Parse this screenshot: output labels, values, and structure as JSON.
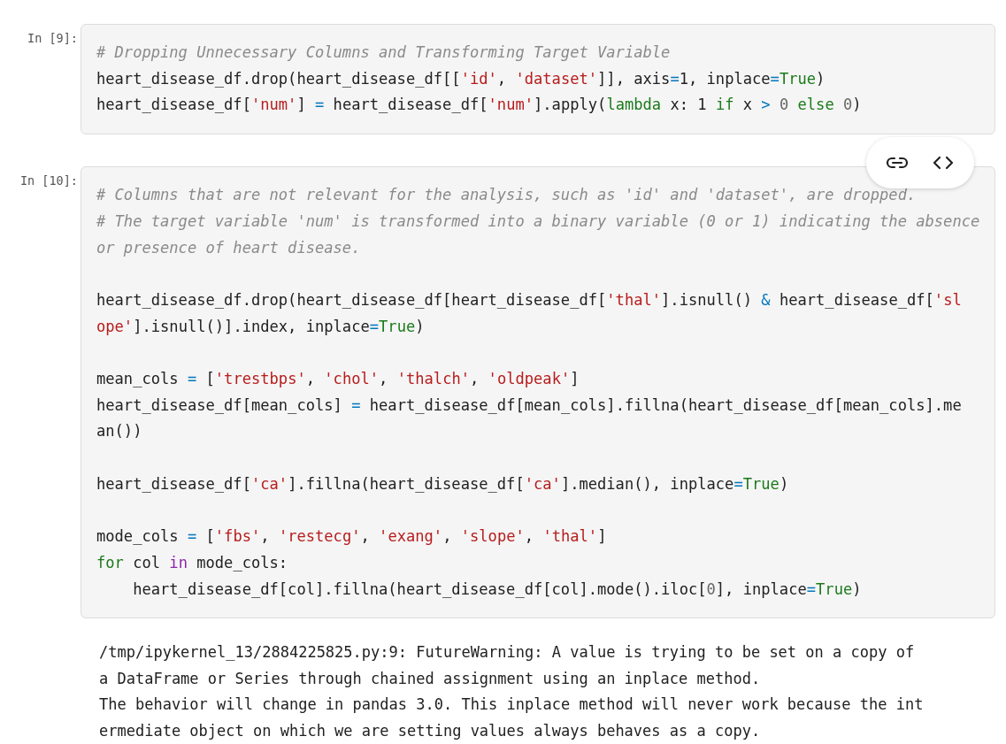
{
  "cells": [
    {
      "prompt": "In [9]:",
      "toolbar": false,
      "lines": [
        {
          "kind": "code",
          "tokens": [
            {
              "text": "# Dropping Unnecessary Columns and Transforming Target Variable",
              "kind": "comment"
            }
          ]
        },
        {
          "kind": "code",
          "tokens": [
            {
              "text": "heart_disease_df.drop(heart_disease_df[[",
              "kind": "plain"
            },
            {
              "text": "'id'",
              "kind": "string"
            },
            {
              "text": ", ",
              "kind": "plain"
            },
            {
              "text": "'dataset'",
              "kind": "string"
            },
            {
              "text": "]], axis",
              "kind": "plain"
            },
            {
              "text": "=",
              "kind": "operator"
            },
            {
              "text": "1",
              "kind": "number"
            },
            {
              "text": ", inplace",
              "kind": "plain"
            },
            {
              "text": "=",
              "kind": "operator"
            },
            {
              "text": "True",
              "kind": "constant"
            },
            {
              "text": ")",
              "kind": "plain"
            }
          ]
        },
        {
          "kind": "code",
          "tokens": [
            {
              "text": "heart_disease_df[",
              "kind": "plain"
            },
            {
              "text": "'num'",
              "kind": "string"
            },
            {
              "text": "] ",
              "kind": "plain"
            },
            {
              "text": "=",
              "kind": "operator"
            },
            {
              "text": " heart_disease_df[",
              "kind": "plain"
            },
            {
              "text": "'num'",
              "kind": "string"
            },
            {
              "text": "].apply(",
              "kind": "plain"
            },
            {
              "text": "lambda",
              "kind": "keyword"
            },
            {
              "text": " x: ",
              "kind": "plain"
            },
            {
              "text": "1",
              "kind": "number"
            },
            {
              "text": " if",
              "kind": "keyword"
            },
            {
              "text": " x ",
              "kind": "plain"
            },
            {
              "text": ">",
              "kind": "operator"
            },
            {
              "text": " 0",
              "kind": "zero"
            },
            {
              "text": " else",
              "kind": "keyword"
            },
            {
              "text": " 0",
              "kind": "zero"
            },
            {
              "text": ")",
              "kind": "plain"
            }
          ]
        }
      ]
    },
    {
      "prompt": "In [10]:",
      "toolbar": true,
      "lines": [
        {
          "kind": "code",
          "tokens": [
            {
              "text": "# Columns that are not relevant for the analysis, such as 'id' and 'dataset', are dropped.",
              "kind": "comment"
            }
          ]
        },
        {
          "kind": "code",
          "tokens": [
            {
              "text": "# The target variable 'num' is transformed into a binary variable (0 or 1) indicating the absence",
              "kind": "comment"
            }
          ]
        },
        {
          "kind": "code",
          "tokens": [
            {
              "text": "or presence of heart disease.",
              "kind": "comment"
            }
          ]
        },
        {
          "kind": "blank"
        },
        {
          "kind": "code",
          "tokens": [
            {
              "text": "heart_disease_df.drop(heart_disease_df[heart_disease_df[",
              "kind": "plain"
            },
            {
              "text": "'thal'",
              "kind": "string"
            },
            {
              "text": "].isnull() ",
              "kind": "plain"
            },
            {
              "text": "&",
              "kind": "operator"
            },
            {
              "text": " heart_disease_df[",
              "kind": "plain"
            },
            {
              "text": "'sl",
              "kind": "string"
            }
          ]
        },
        {
          "kind": "code",
          "tokens": [
            {
              "text": "ope'",
              "kind": "string"
            },
            {
              "text": "].isnull()].index, inplace",
              "kind": "plain"
            },
            {
              "text": "=",
              "kind": "operator"
            },
            {
              "text": "True",
              "kind": "constant"
            },
            {
              "text": ")",
              "kind": "plain"
            }
          ]
        },
        {
          "kind": "blank"
        },
        {
          "kind": "code",
          "tokens": [
            {
              "text": "mean_cols ",
              "kind": "plain"
            },
            {
              "text": "=",
              "kind": "operator"
            },
            {
              "text": " [",
              "kind": "plain"
            },
            {
              "text": "'trestbps'",
              "kind": "string"
            },
            {
              "text": ", ",
              "kind": "plain"
            },
            {
              "text": "'chol'",
              "kind": "string"
            },
            {
              "text": ", ",
              "kind": "plain"
            },
            {
              "text": "'thalch'",
              "kind": "string"
            },
            {
              "text": ", ",
              "kind": "plain"
            },
            {
              "text": "'oldpeak'",
              "kind": "string"
            },
            {
              "text": "]",
              "kind": "plain"
            }
          ]
        },
        {
          "kind": "code",
          "tokens": [
            {
              "text": "heart_disease_df[mean_cols] ",
              "kind": "plain"
            },
            {
              "text": "=",
              "kind": "operator"
            },
            {
              "text": " heart_disease_df[mean_cols].fillna(heart_disease_df[mean_cols].me",
              "kind": "plain"
            }
          ]
        },
        {
          "kind": "code",
          "tokens": [
            {
              "text": "an())",
              "kind": "plain"
            }
          ]
        },
        {
          "kind": "blank"
        },
        {
          "kind": "code",
          "tokens": [
            {
              "text": "heart_disease_df[",
              "kind": "plain"
            },
            {
              "text": "'ca'",
              "kind": "string"
            },
            {
              "text": "].fillna(heart_disease_df[",
              "kind": "plain"
            },
            {
              "text": "'ca'",
              "kind": "string"
            },
            {
              "text": "].median(), inplace",
              "kind": "plain"
            },
            {
              "text": "=",
              "kind": "operator"
            },
            {
              "text": "True",
              "kind": "constant"
            },
            {
              "text": ")",
              "kind": "plain"
            }
          ]
        },
        {
          "kind": "blank"
        },
        {
          "kind": "code",
          "tokens": [
            {
              "text": "mode_cols ",
              "kind": "plain"
            },
            {
              "text": "=",
              "kind": "operator"
            },
            {
              "text": " [",
              "kind": "plain"
            },
            {
              "text": "'fbs'",
              "kind": "string"
            },
            {
              "text": ", ",
              "kind": "plain"
            },
            {
              "text": "'restecg'",
              "kind": "string"
            },
            {
              "text": ", ",
              "kind": "plain"
            },
            {
              "text": "'exang'",
              "kind": "string"
            },
            {
              "text": ", ",
              "kind": "plain"
            },
            {
              "text": "'slope'",
              "kind": "string"
            },
            {
              "text": ", ",
              "kind": "plain"
            },
            {
              "text": "'thal'",
              "kind": "string"
            },
            {
              "text": "]",
              "kind": "plain"
            }
          ]
        },
        {
          "kind": "code",
          "tokens": [
            {
              "text": "for",
              "kind": "keyword"
            },
            {
              "text": " col ",
              "kind": "plain"
            },
            {
              "text": "in",
              "kind": "membership"
            },
            {
              "text": " mode_cols:",
              "kind": "plain"
            }
          ]
        },
        {
          "kind": "code",
          "tokens": [
            {
              "text": "    heart_disease_df[col].fillna(heart_disease_df[col].mode().iloc[",
              "kind": "plain"
            },
            {
              "text": "0",
              "kind": "zero"
            },
            {
              "text": "], inplace",
              "kind": "plain"
            },
            {
              "text": "=",
              "kind": "operator"
            },
            {
              "text": "True",
              "kind": "constant"
            },
            {
              "text": ")",
              "kind": "plain"
            }
          ]
        }
      ]
    }
  ],
  "output": [
    "/tmp/ipykernel_13/2884225825.py:9: FutureWarning: A value is trying to be set on a copy of",
    "a DataFrame or Series through chained assignment using an inplace method.",
    "The behavior will change in pandas 3.0. This inplace method will never work because the int",
    "ermediate object on which we are setting values always behaves as a copy."
  ]
}
